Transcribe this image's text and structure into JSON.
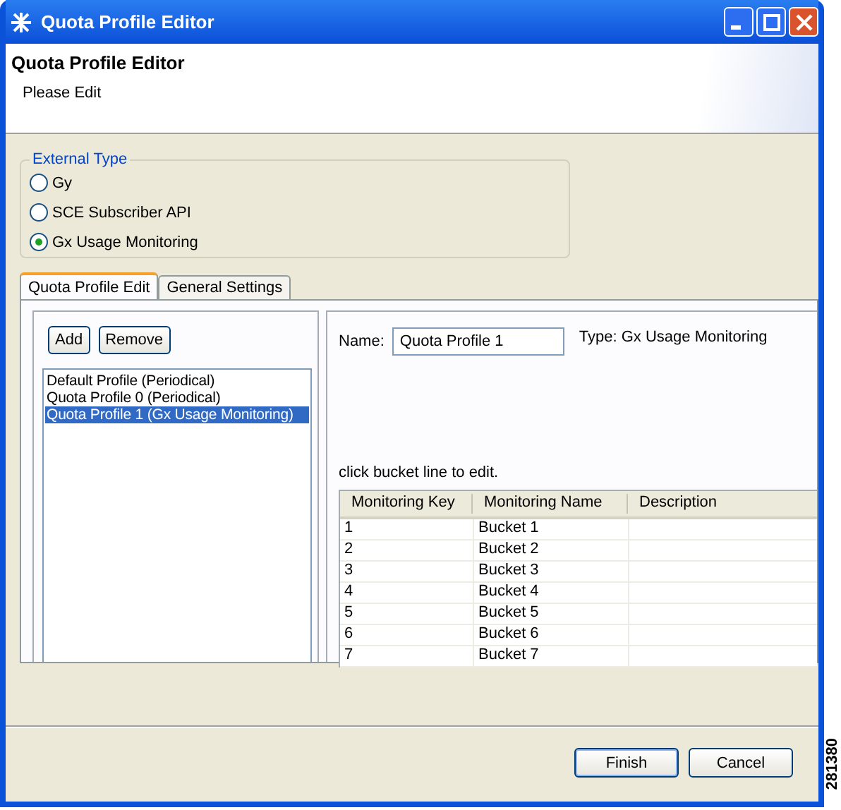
{
  "window": {
    "title": "Quota Profile Editor"
  },
  "header": {
    "title": "Quota Profile Editor",
    "subtitle": "Please Edit"
  },
  "external_type": {
    "legend": "External Type",
    "options": [
      {
        "label": "Gy",
        "selected": false
      },
      {
        "label": "SCE Subscriber API",
        "selected": false
      },
      {
        "label": "Gx Usage Monitoring",
        "selected": true
      }
    ]
  },
  "tabs": [
    {
      "label": "Quota Profile Edit",
      "selected": true
    },
    {
      "label": "General Settings",
      "selected": false
    }
  ],
  "profiles": {
    "buttons": [
      "Add",
      "Remove"
    ],
    "items": [
      {
        "label": "Default Profile (Periodical)",
        "selected": false
      },
      {
        "label": "Quota Profile 0 (Periodical)",
        "selected": false
      },
      {
        "label": "Quota Profile 1 (Gx Usage Monitoring)",
        "selected": true
      }
    ]
  },
  "editor": {
    "name_label": "Name:",
    "name_value": "Quota Profile 1",
    "type_text": "Type: Gx Usage Monitoring",
    "hint": "click bucket line to edit."
  },
  "table": {
    "columns": [
      "Monitoring Key",
      "Monitoring Name",
      "Description"
    ],
    "rows": [
      [
        "1",
        "Bucket 1",
        ""
      ],
      [
        "2",
        "Bucket 2",
        ""
      ],
      [
        "3",
        "Bucket 3",
        ""
      ],
      [
        "4",
        "Bucket 4",
        ""
      ],
      [
        "5",
        "Bucket 5",
        ""
      ],
      [
        "6",
        "Bucket 6",
        ""
      ],
      [
        "7",
        "Bucket 7",
        ""
      ]
    ]
  },
  "buttons": [
    "Finish",
    "Cancel"
  ],
  "figure_id": "281380"
}
